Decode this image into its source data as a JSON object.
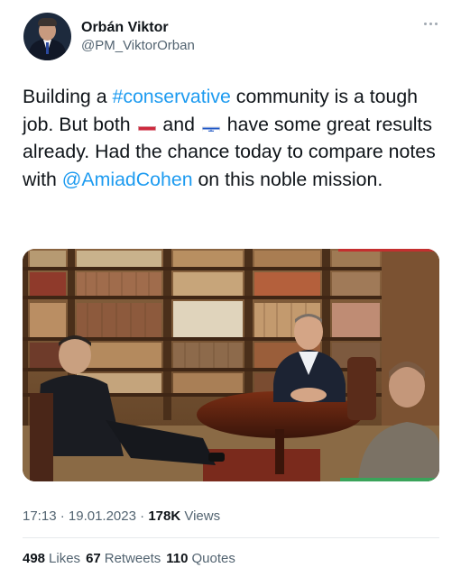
{
  "author": {
    "name": "Orbán Viktor",
    "handle": "@PM_ViktorOrban"
  },
  "tweet": {
    "text_1": "Building a ",
    "hashtag": "#conservative",
    "text_2": " community is a tough job. But both ",
    "flag_1": "hungary-flag",
    "text_3": " and ",
    "flag_2": "israel-flag",
    "text_4": " have some great results already. Had the chance today to compare notes with ",
    "mention": "@AmiadCohen",
    "text_5": " on this noble mission."
  },
  "meta": {
    "time": "17:13",
    "separator_1": " · ",
    "date": "19.01.2023",
    "separator_2": " · ",
    "views_count": "178K",
    "views_label": "Views"
  },
  "stats": {
    "likes_count": "498",
    "likes_label": "Likes",
    "retweets_count": "67",
    "retweets_label": "Retweets",
    "quotes_count": "110",
    "quotes_label": "Quotes"
  },
  "colors": {
    "link": "#1d9bf0",
    "muted": "#536471",
    "text": "#0f1419"
  },
  "icons": [
    "more-options-icon",
    "hungary-flag-icon",
    "israel-flag-icon"
  ]
}
